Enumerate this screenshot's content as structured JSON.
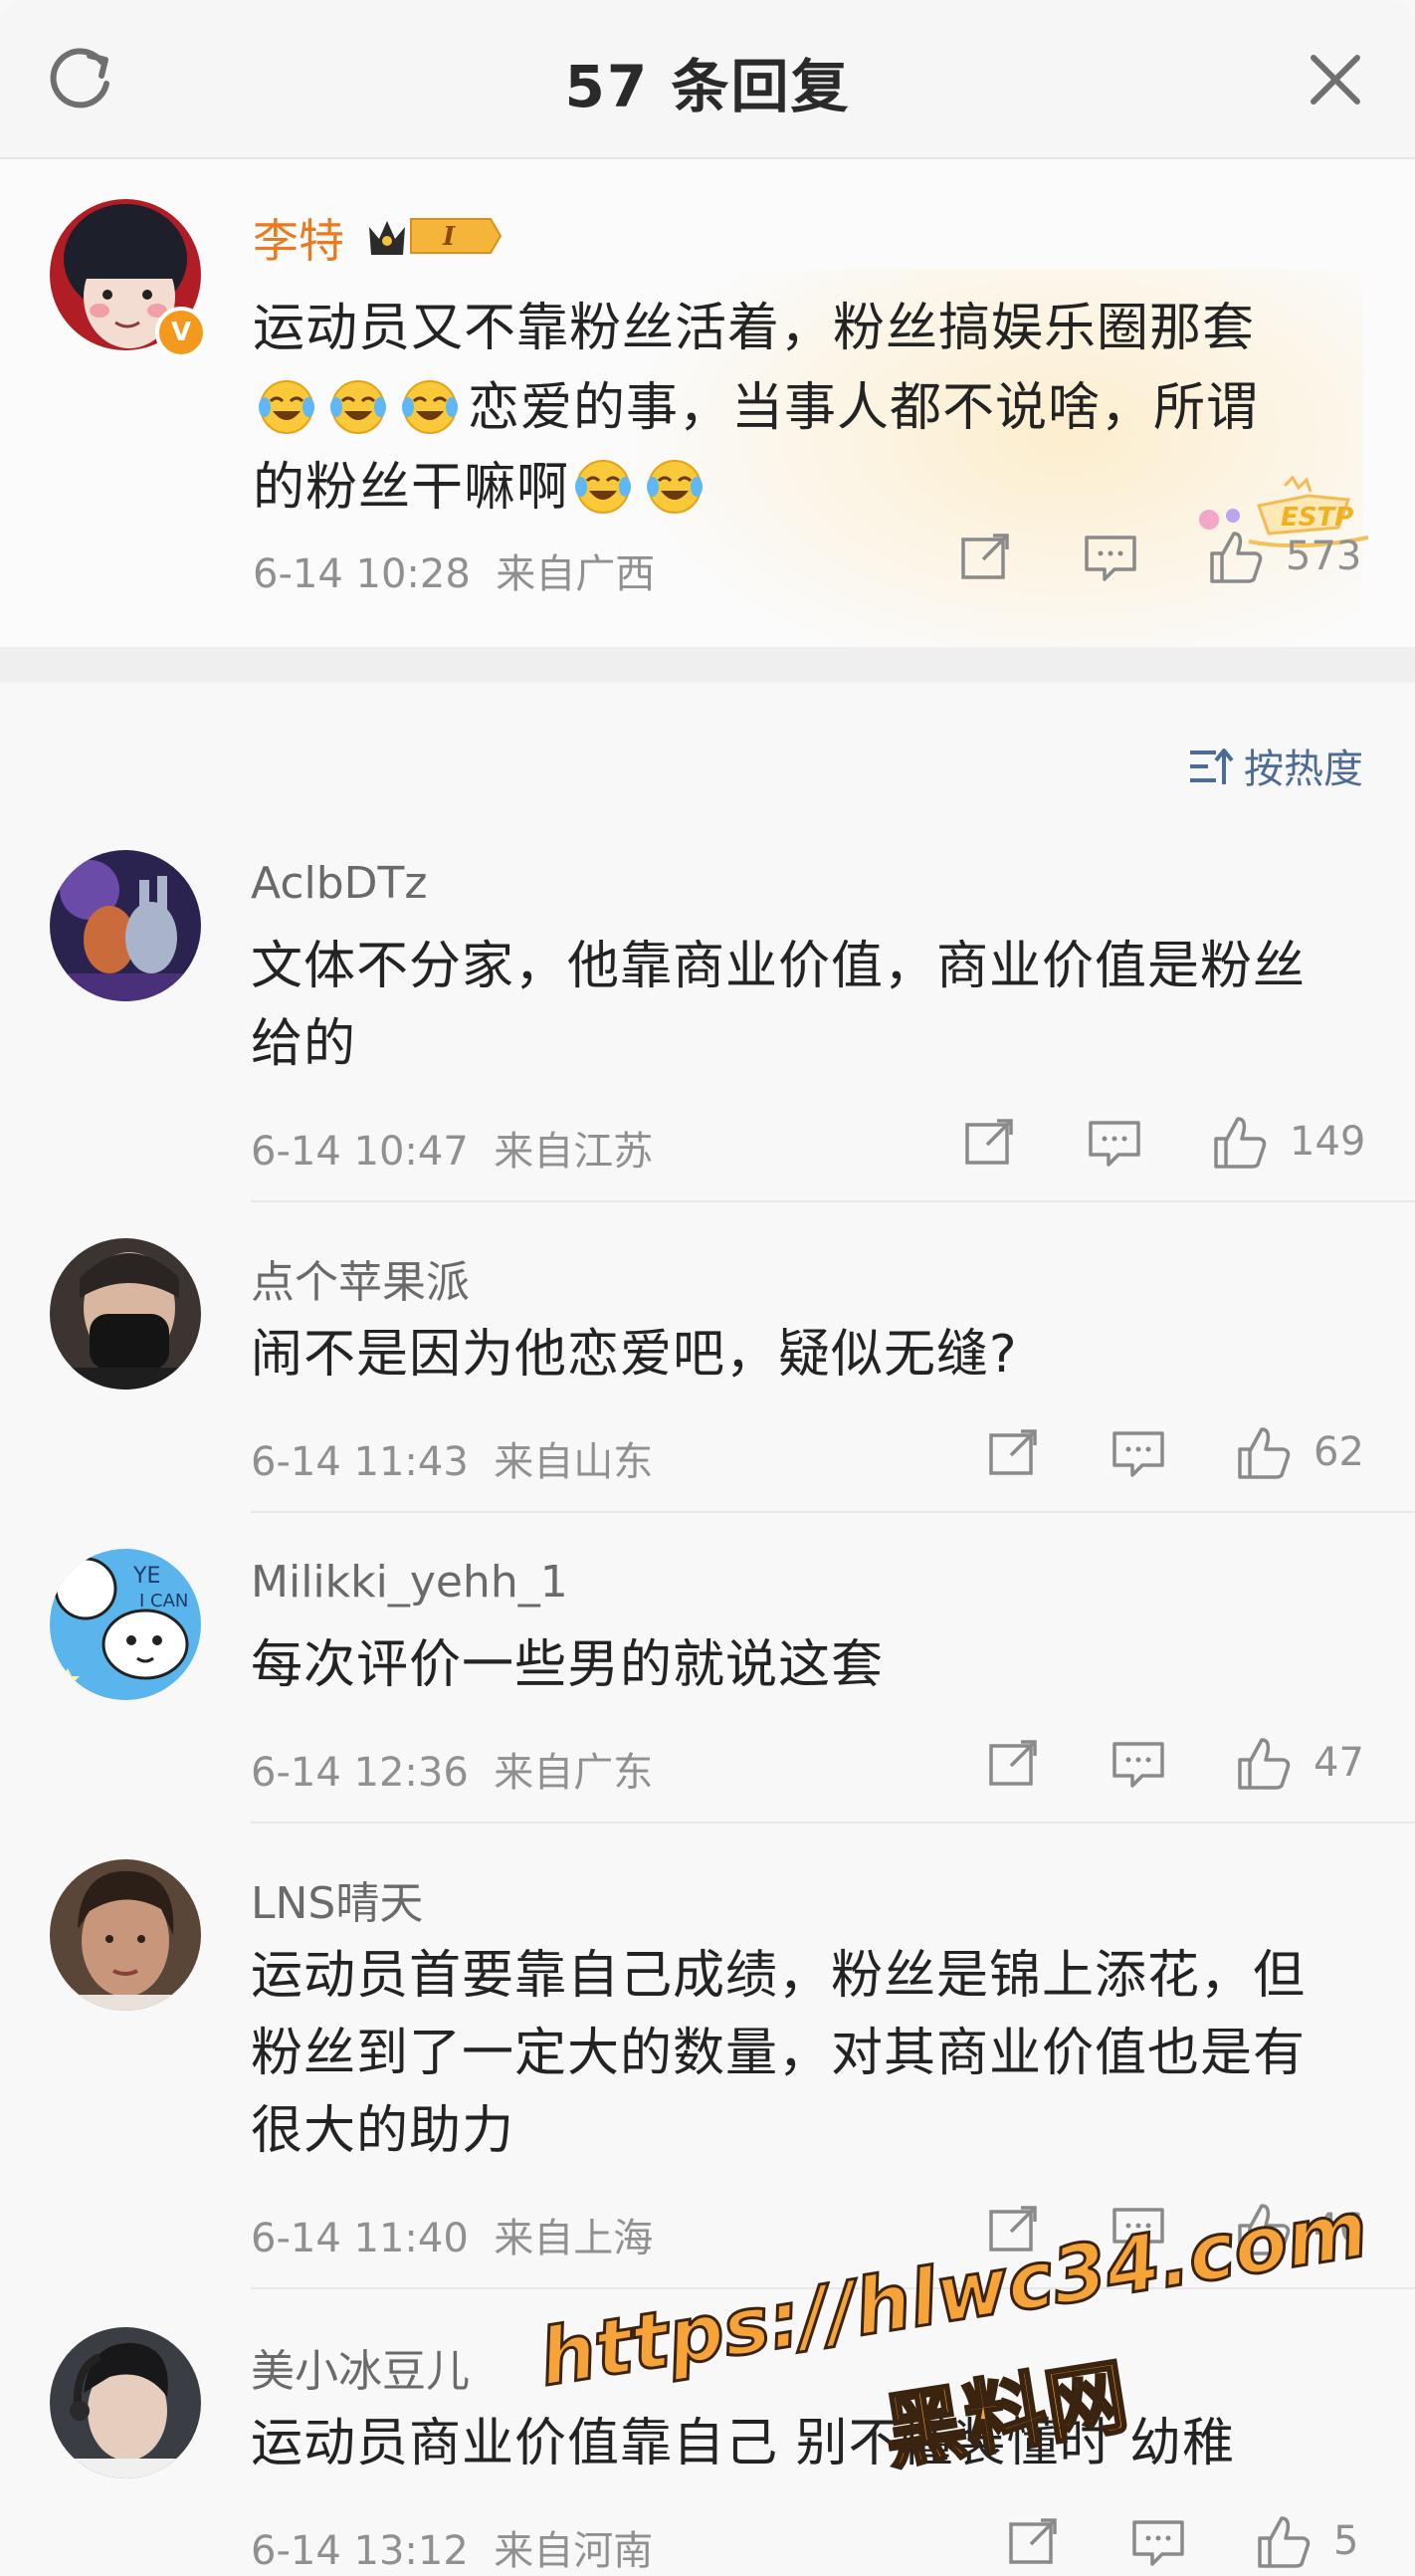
{
  "header": {
    "title": "57 条回复",
    "refresh_icon": "refresh-icon",
    "close_icon": "close-icon"
  },
  "root_comment": {
    "username": "李特",
    "badge_text": "I",
    "text_line1": "运动员又不靠粉丝活着，粉丝搞娱乐圈那套",
    "text_line2": "恋爱的事，当事人都不说啥，所谓",
    "text_line3": "的粉丝干嘛啊",
    "date": "6-14 10:28",
    "location": "来自广西",
    "likes": "573",
    "decor_text": "ESTP",
    "verified_mark": "V"
  },
  "sort": {
    "label": "按热度"
  },
  "replies": [
    {
      "username": "AclbDTz",
      "text": "文体不分家，他靠商业价值，商业价值是粉丝给的",
      "date": "6-14 10:47",
      "location": "来自江苏",
      "likes": "149"
    },
    {
      "username": "点个苹果派",
      "text": "闹不是因为他恋爱吧，疑似无缝?",
      "date": "6-14 11:43",
      "location": "来自山东",
      "likes": "62"
    },
    {
      "username": "Milikki_yehh_1",
      "text": "每次评价一些男的就说这套",
      "date": "6-14 12:36",
      "location": "来自广东",
      "likes": "47"
    },
    {
      "username": "LNS晴天",
      "text": "运动员首要靠自己成绩，粉丝是锦上添花，但粉丝到了一定大的数量，对其商业价值也是有很大的助力",
      "date": "6-14 11:40",
      "location": "来自上海",
      "likes": "46"
    },
    {
      "username": "美小冰豆儿",
      "text": "运动员商业价值靠自己 别不懂装懂时 幼稚",
      "date": "6-14 13:12",
      "location": "来自河南",
      "likes": "5"
    }
  ],
  "watermark": {
    "url": "https://hlwc34.com",
    "name": "黑料网"
  },
  "colors": {
    "username_orange": "#eb7a1f",
    "sort_blue": "#4d6c95",
    "meta_gray": "#909090",
    "watermark_orange": "#f6a33a"
  }
}
